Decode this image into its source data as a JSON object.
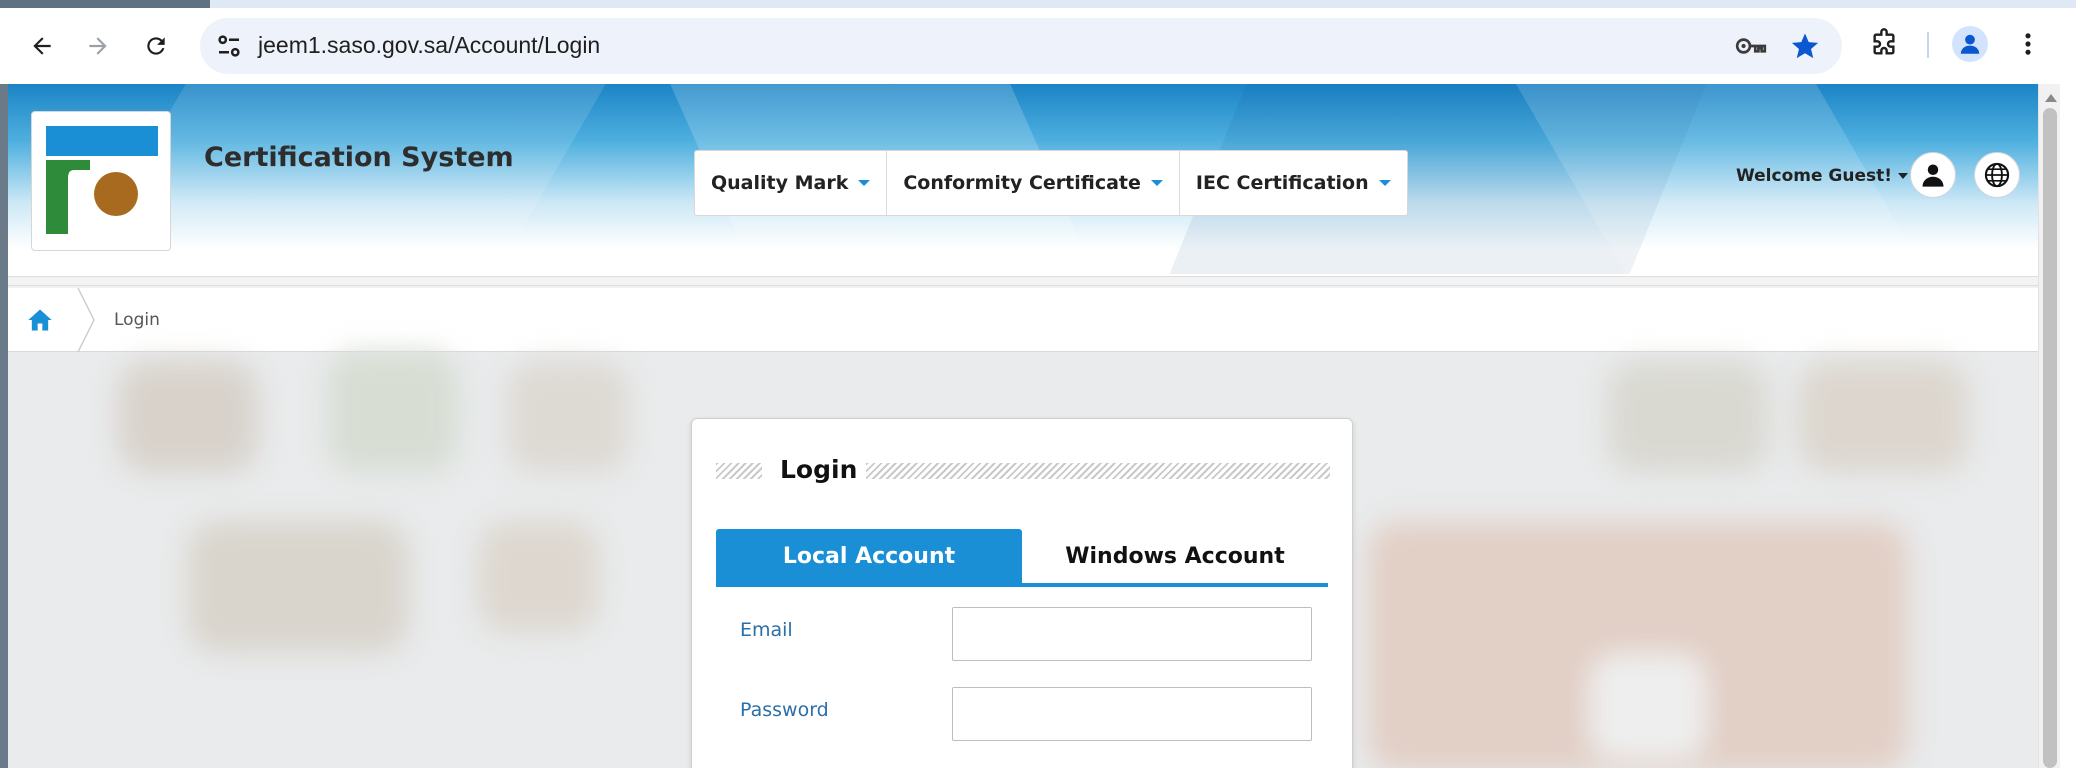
{
  "browser": {
    "url": "jeem1.saso.gov.sa/Account/Login"
  },
  "header": {
    "site_title": "Certification System",
    "nav": [
      {
        "label": "Quality Mark"
      },
      {
        "label": "Conformity Certificate"
      },
      {
        "label": "IEC Certification"
      }
    ],
    "welcome": "Welcome Guest!"
  },
  "breadcrumb": {
    "current": "Login"
  },
  "login": {
    "title": "Login",
    "tabs": [
      {
        "label": "Local Account",
        "active": true
      },
      {
        "label": "Windows Account",
        "active": false
      }
    ],
    "email_label": "Email",
    "email_value": "",
    "password_label": "Password",
    "password_value": ""
  },
  "colors": {
    "accent": "#1a8fd6",
    "label": "#2a6fa8",
    "logo_blue": "#1a8fd6",
    "logo_green": "#2e8b3a",
    "logo_brown": "#a86a1e"
  },
  "icons": {
    "back": "arrow-left-icon",
    "forward": "arrow-right-icon",
    "reload": "reload-icon",
    "site_info": "tune-icon",
    "password_manager": "key-icon",
    "bookmark": "star-icon",
    "extensions": "puzzle-icon",
    "profile": "profile-icon",
    "menu": "kebab-menu-icon",
    "user": "user-icon",
    "language": "globe-icon",
    "home": "home-icon"
  }
}
